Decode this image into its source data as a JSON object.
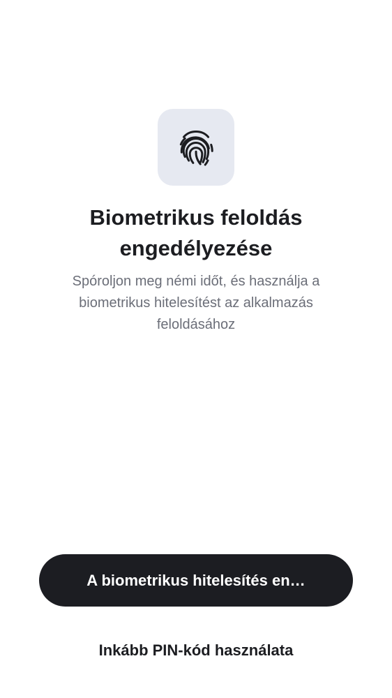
{
  "icon": {
    "name": "fingerprint-icon",
    "tile_color": "#e6e9f1",
    "stroke_color": "#1c1d21"
  },
  "title": "Biometrikus feloldás engedélyezése",
  "subtitle": "Spóroljon meg némi időt, és használja a biometrikus hitelesítést az alkalmazás feloldásához",
  "primary_button": {
    "label": "A biometrikus hitelesítés en…"
  },
  "secondary_link": {
    "label": "Inkább PIN-kód használata"
  },
  "colors": {
    "background": "#ffffff",
    "primary": "#1c1d22",
    "text": "#1c1d21",
    "muted_text": "#6b6e78"
  }
}
